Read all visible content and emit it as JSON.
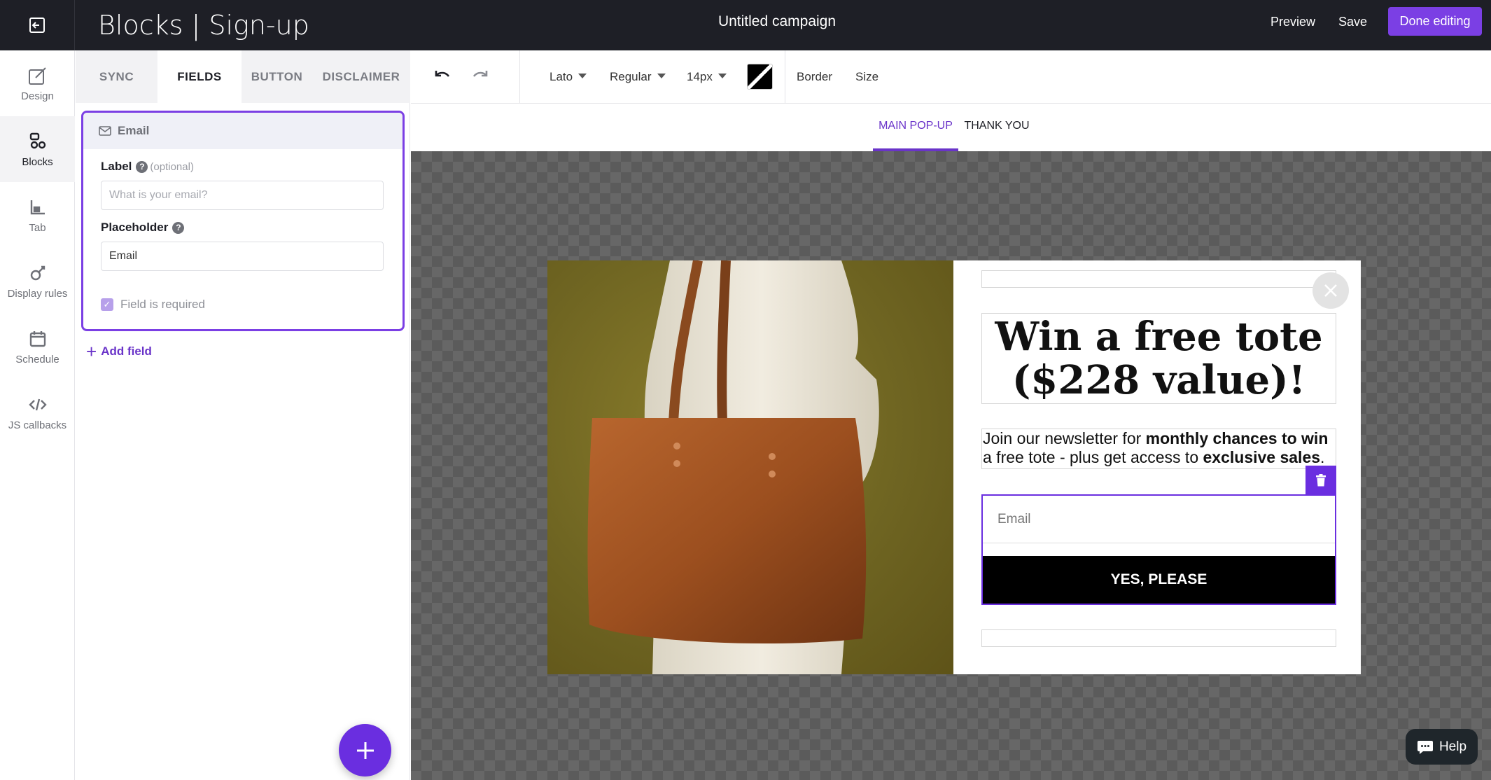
{
  "topbar": {
    "app_title": "Blocks | Sign-up",
    "campaign_name": "Untitled campaign",
    "preview_label": "Preview",
    "save_label": "Save",
    "done_label": "Done editing",
    "exit_icon": "exit-icon"
  },
  "sidebar": {
    "items": [
      {
        "label": "Design",
        "icon": "brush-icon"
      },
      {
        "label": "Blocks",
        "icon": "blocks-icon"
      },
      {
        "label": "Tab",
        "icon": "tab-icon"
      },
      {
        "label": "Display rules",
        "icon": "display-rules-icon"
      },
      {
        "label": "Schedule",
        "icon": "calendar-icon"
      },
      {
        "label": "JS callbacks",
        "icon": "code-icon"
      }
    ],
    "active": "Blocks"
  },
  "panel": {
    "tabs": [
      "SYNC",
      "FIELDS",
      "BUTTON",
      "DISCLAIMER"
    ],
    "active_tab": "FIELDS",
    "field_card": {
      "title": "Email",
      "label_heading": "Label",
      "label_optional": "(optional)",
      "label_placeholder": "What is your email?",
      "placeholder_heading": "Placeholder",
      "placeholder_value": "Email",
      "required_label": "Field is required",
      "required_checked": true
    },
    "add_field_label": "Add field"
  },
  "toolbar": {
    "font_family": "Lato",
    "font_weight": "Regular",
    "font_size": "14px",
    "border_label": "Border",
    "size_label": "Size"
  },
  "canvas_tabs": [
    "MAIN POP-UP",
    "THANK YOU"
  ],
  "canvas_active_tab": "MAIN POP-UP",
  "popup": {
    "headline": "Win a free tote ($228 value)!",
    "body_part1": "Join our newsletter for ",
    "body_bold1": "monthly chances to win",
    "body_part2": " a free tote - plus get access to ",
    "body_bold2": "exclusive sales",
    "body_part3": ".",
    "email_placeholder": "Email",
    "cta_label": "YES, PLEASE"
  },
  "help_label": "Help",
  "colors": {
    "accent": "#7b3fe4",
    "topbar_bg": "#1e1f26",
    "cta_bg": "#000000"
  }
}
